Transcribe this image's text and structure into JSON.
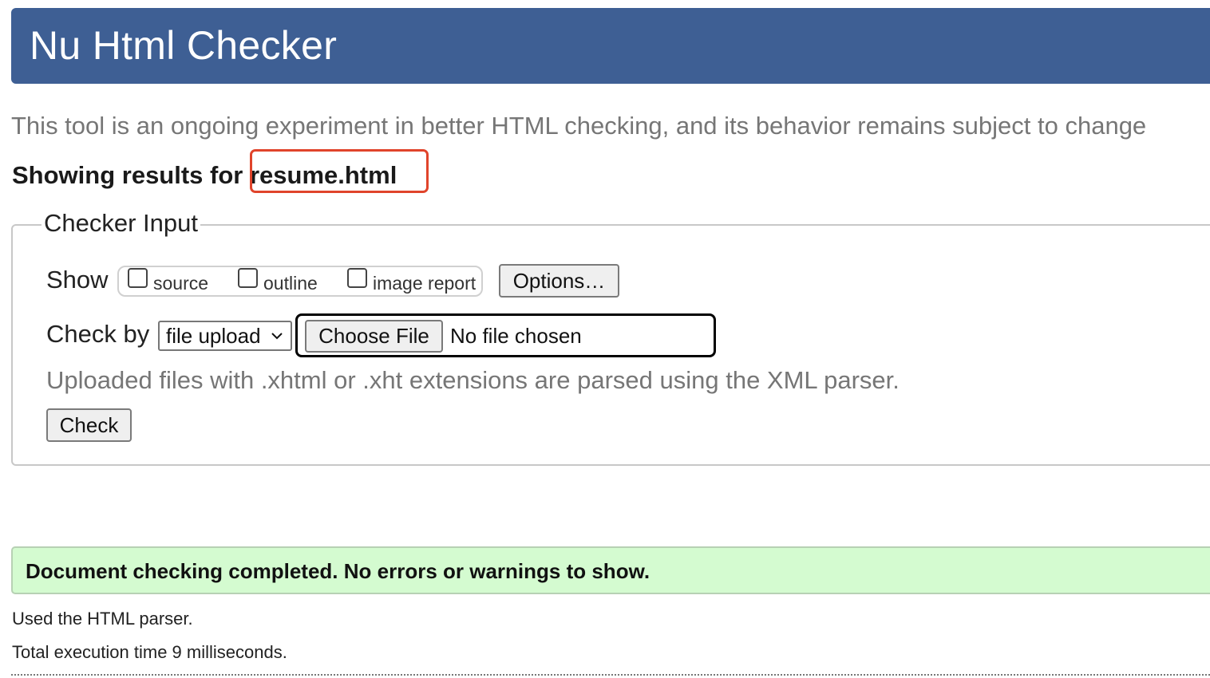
{
  "header": {
    "title": "Nu Html Checker"
  },
  "intro": "This tool is an ongoing experiment in better HTML checking, and its behavior remains subject to change",
  "results": {
    "prefix": "Showing results for ",
    "filename": "resume.html"
  },
  "checker_input": {
    "legend": "Checker Input",
    "show_label": "Show",
    "show_options": [
      {
        "label": "source",
        "checked": false
      },
      {
        "label": "outline",
        "checked": false
      },
      {
        "label": "image report",
        "checked": false
      }
    ],
    "options_button": "Options…",
    "check_by_label": "Check by",
    "check_by_value": "file upload",
    "choose_file_button": "Choose File",
    "file_status": "No file chosen",
    "note": "Uploaded files with .xhtml or .xht extensions are parsed using the XML parser.",
    "check_button": "Check"
  },
  "status": {
    "message": "Document checking completed. No errors or warnings to show.",
    "parser_info": "Used the HTML parser.",
    "execution_time": "Total execution time 9 milliseconds."
  },
  "colors": {
    "header_bg": "#3e5f94",
    "success_bg": "#d4fbd0",
    "highlight_border": "#e0442b"
  }
}
